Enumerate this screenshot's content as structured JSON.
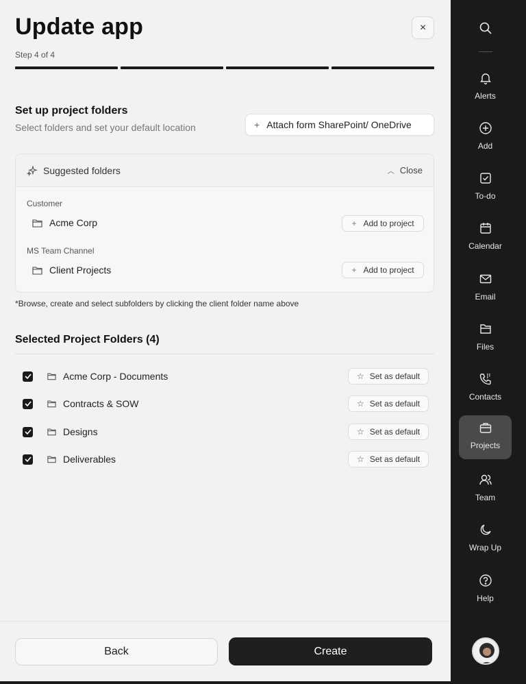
{
  "header": {
    "title": "Update app",
    "close_label": "×",
    "step": "Step 4 of 4",
    "progress": {
      "current": 4,
      "total": 4
    }
  },
  "setup": {
    "title": "Set up project folders",
    "subtitle": "Select folders and set your default location",
    "attach_button": "Attach form SharePoint/ OneDrive"
  },
  "suggested": {
    "header_label": "Suggested folders",
    "toggle_label": "Close",
    "groups": [
      {
        "label": "Customer",
        "folder": "Acme Corp",
        "button": "Add to project"
      },
      {
        "label": "MS Team Channel",
        "folder": "Client Projects",
        "button": "Add to project"
      }
    ]
  },
  "footnote": "*Browse, create and select subfolders by clicking the client folder name above",
  "selected": {
    "title": "Selected Project Folders (4)",
    "default_button": "Set as default",
    "folders": [
      {
        "name": "Acme Corp - Documents",
        "checked": true
      },
      {
        "name": "Contracts & SOW",
        "checked": true
      },
      {
        "name": "Designs",
        "checked": true
      },
      {
        "name": "Deliverables",
        "checked": true
      }
    ]
  },
  "footer": {
    "back_label": "Back",
    "create_label": "Create"
  },
  "sidebar": {
    "items": [
      {
        "label": "Alerts",
        "icon": "bell-icon"
      },
      {
        "label": "Add",
        "icon": "plus-circle-icon"
      },
      {
        "label": "To-do",
        "icon": "checkbox-icon"
      },
      {
        "label": "Calendar",
        "icon": "calendar-icon"
      },
      {
        "label": "Email",
        "icon": "mail-icon"
      },
      {
        "label": "Files",
        "icon": "folder-icon"
      },
      {
        "label": "Contacts",
        "icon": "phone-icon"
      },
      {
        "label": "Projects",
        "icon": "briefcase-icon",
        "active": true
      },
      {
        "label": "Team",
        "icon": "users-icon"
      },
      {
        "label": "Wrap Up",
        "icon": "moon-icon"
      },
      {
        "label": "Help",
        "icon": "help-icon"
      }
    ]
  },
  "colors": {
    "panel_bg": "#f2f2f2",
    "sidebar_bg": "#1a1a1a",
    "active_item_bg": "#4a4a4a",
    "primary_button": "#1f1f1f"
  }
}
